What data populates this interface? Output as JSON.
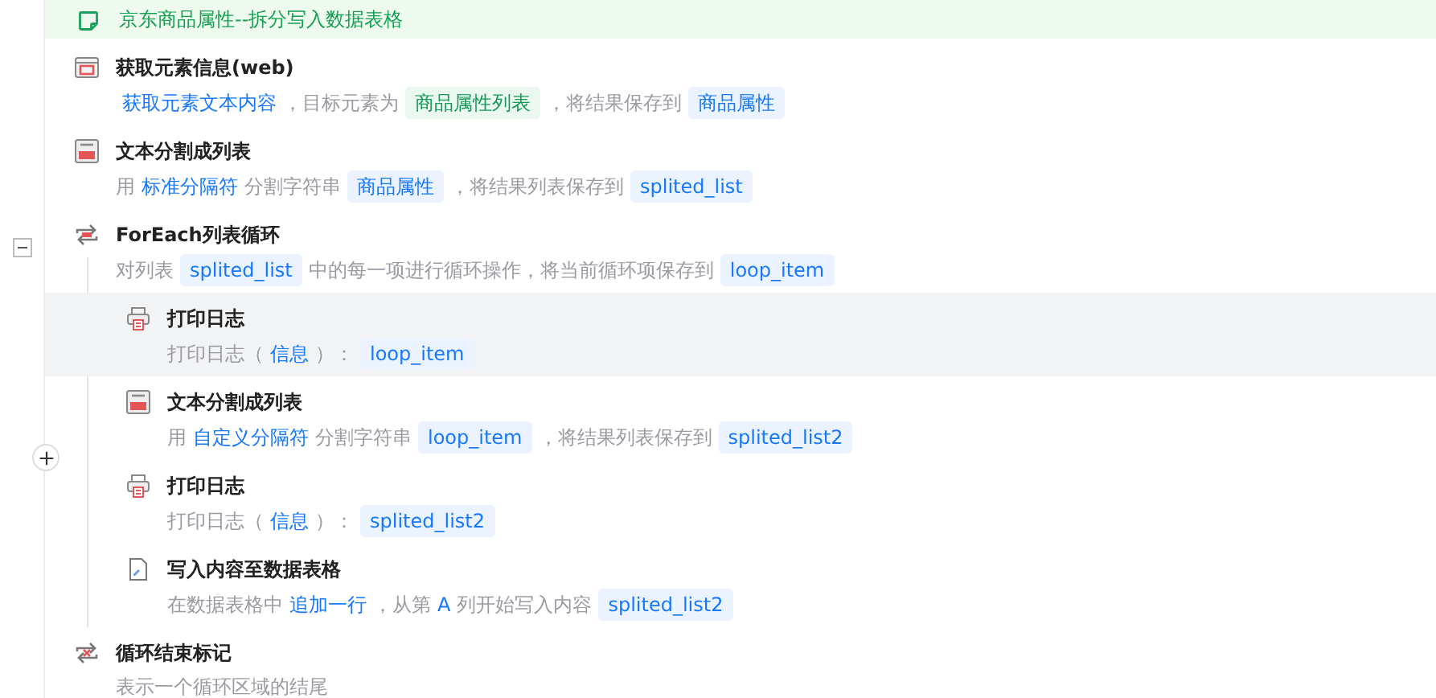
{
  "comment": {
    "text": "京东商品属性--拆分写入数据表格"
  },
  "steps": [
    {
      "kind": "browser",
      "title": "获取元素信息(web)",
      "selected": false,
      "desc": [
        {
          "kind": "link",
          "text": "获取元素文本内容"
        },
        {
          "kind": "text",
          "text": "，目标元素为"
        },
        {
          "kind": "tag",
          "text": "商品属性列表"
        },
        {
          "kind": "text",
          "text": "，将结果保存到"
        },
        {
          "kind": "var",
          "text": "商品属性"
        }
      ]
    },
    {
      "kind": "split",
      "title": "文本分割成列表",
      "selected": false,
      "desc": [
        {
          "kind": "text",
          "text": "用"
        },
        {
          "kind": "link",
          "text": "标准分隔符"
        },
        {
          "kind": "text",
          "text": "分割字符串"
        },
        {
          "kind": "var",
          "text": "商品属性"
        },
        {
          "kind": "text",
          "text": "，将结果列表保存到"
        },
        {
          "kind": "var",
          "text": "splited_list"
        }
      ]
    },
    {
      "kind": "loop",
      "title": "ForEach列表循环",
      "selected": false,
      "expanded": true,
      "desc": [
        {
          "kind": "text",
          "text": "对列表"
        },
        {
          "kind": "var",
          "text": "splited_list"
        },
        {
          "kind": "text",
          "text": "中的每一项进行循环操作，将当前循环项保存到"
        },
        {
          "kind": "var",
          "text": "loop_item"
        }
      ],
      "children": [
        {
          "kind": "print",
          "title": "打印日志",
          "selected": true,
          "desc": [
            {
              "kind": "text",
              "text": "打印日志（"
            },
            {
              "kind": "link",
              "text": "信息"
            },
            {
              "kind": "text",
              "text": "）："
            },
            {
              "kind": "var",
              "text": "loop_item"
            }
          ]
        },
        {
          "kind": "split",
          "title": "文本分割成列表",
          "selected": false,
          "desc": [
            {
              "kind": "text",
              "text": "用"
            },
            {
              "kind": "link",
              "text": "自定义分隔符"
            },
            {
              "kind": "text",
              "text": "分割字符串"
            },
            {
              "kind": "var",
              "text": "loop_item"
            },
            {
              "kind": "text",
              "text": "，将结果列表保存到"
            },
            {
              "kind": "var",
              "text": "splited_list2"
            }
          ]
        },
        {
          "kind": "print",
          "title": "打印日志",
          "selected": false,
          "desc": [
            {
              "kind": "text",
              "text": "打印日志（"
            },
            {
              "kind": "link",
              "text": "信息"
            },
            {
              "kind": "text",
              "text": "）："
            },
            {
              "kind": "var",
              "text": "splited_list2"
            }
          ]
        },
        {
          "kind": "write",
          "title": "写入内容至数据表格",
          "selected": false,
          "desc": [
            {
              "kind": "text",
              "text": "在数据表格中"
            },
            {
              "kind": "link",
              "text": "追加一行"
            },
            {
              "kind": "text",
              "text": "，从第"
            },
            {
              "kind": "link",
              "text": "A"
            },
            {
              "kind": "text",
              "text": "列开始写入内容"
            },
            {
              "kind": "var",
              "text": "splited_list2"
            }
          ]
        }
      ]
    },
    {
      "kind": "loop-end",
      "title": "循环结束标记",
      "selected": false,
      "desc": [
        {
          "kind": "text",
          "text": "表示一个循环区域的结尾"
        }
      ]
    }
  ]
}
